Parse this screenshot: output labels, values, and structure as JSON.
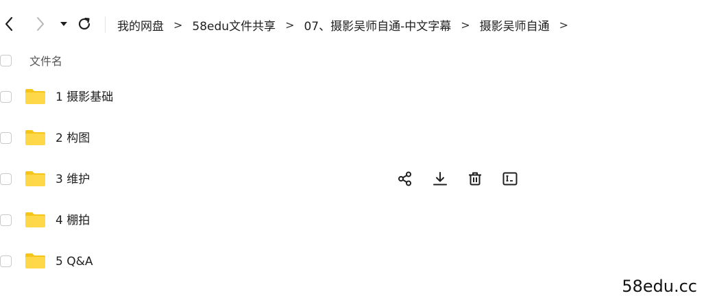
{
  "toolbar": {
    "back_icon": "chevron-left-icon",
    "forward_icon": "chevron-right-icon",
    "dropdown_icon": "caret-down-icon",
    "refresh_icon": "refresh-icon"
  },
  "breadcrumb": {
    "items": [
      "我的网盘",
      "58edu文件共享",
      "07、摄影吴师自通-中文字幕",
      "摄影吴师自通"
    ],
    "separator": ">"
  },
  "list": {
    "header_label": "文件名",
    "items": [
      {
        "label": "1 摄影基础",
        "icon": "folder-icon"
      },
      {
        "label": "2 构图",
        "icon": "folder-icon"
      },
      {
        "label": "3 维护",
        "icon": "folder-icon"
      },
      {
        "label": "4 棚拍",
        "icon": "folder-icon"
      },
      {
        "label": "5 Q&A",
        "icon": "folder-icon"
      }
    ]
  },
  "row_actions": [
    "share-icon",
    "download-icon",
    "delete-icon",
    "rename-icon"
  ],
  "watermark": "58edu.cc",
  "colors": {
    "folder": "#FFD84A",
    "folder_tab": "#F5C518",
    "checkbox_border": "#c9c9c9"
  }
}
